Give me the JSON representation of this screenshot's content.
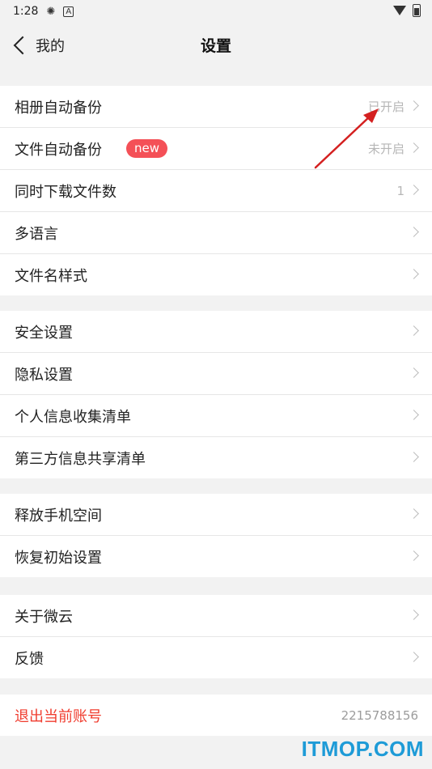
{
  "status_bar": {
    "time": "1:28",
    "icon_a": "A"
  },
  "header": {
    "back_label": "我的",
    "title": "设置"
  },
  "groups": {
    "g1": [
      {
        "label": "相册自动备份",
        "value": "已开启"
      },
      {
        "label": "文件自动备份",
        "badge": "new",
        "value": "未开启"
      },
      {
        "label": "同时下载文件数",
        "value": "1"
      },
      {
        "label": "多语言"
      },
      {
        "label": "文件名样式"
      }
    ],
    "g2": [
      {
        "label": "安全设置"
      },
      {
        "label": "隐私设置"
      },
      {
        "label": "个人信息收集清单"
      },
      {
        "label": "第三方信息共享清单"
      }
    ],
    "g3": [
      {
        "label": "释放手机空间"
      },
      {
        "label": "恢复初始设置"
      }
    ],
    "g4": [
      {
        "label": "关于微云"
      },
      {
        "label": "反馈"
      }
    ],
    "g5": [
      {
        "label": "退出当前账号",
        "value": "2215788156"
      }
    ]
  },
  "watermark": "ITMOP.COM",
  "colors": {
    "accent_red": "#f03c2e",
    "badge": "#f45057",
    "watermark": "#1e9bd7"
  }
}
